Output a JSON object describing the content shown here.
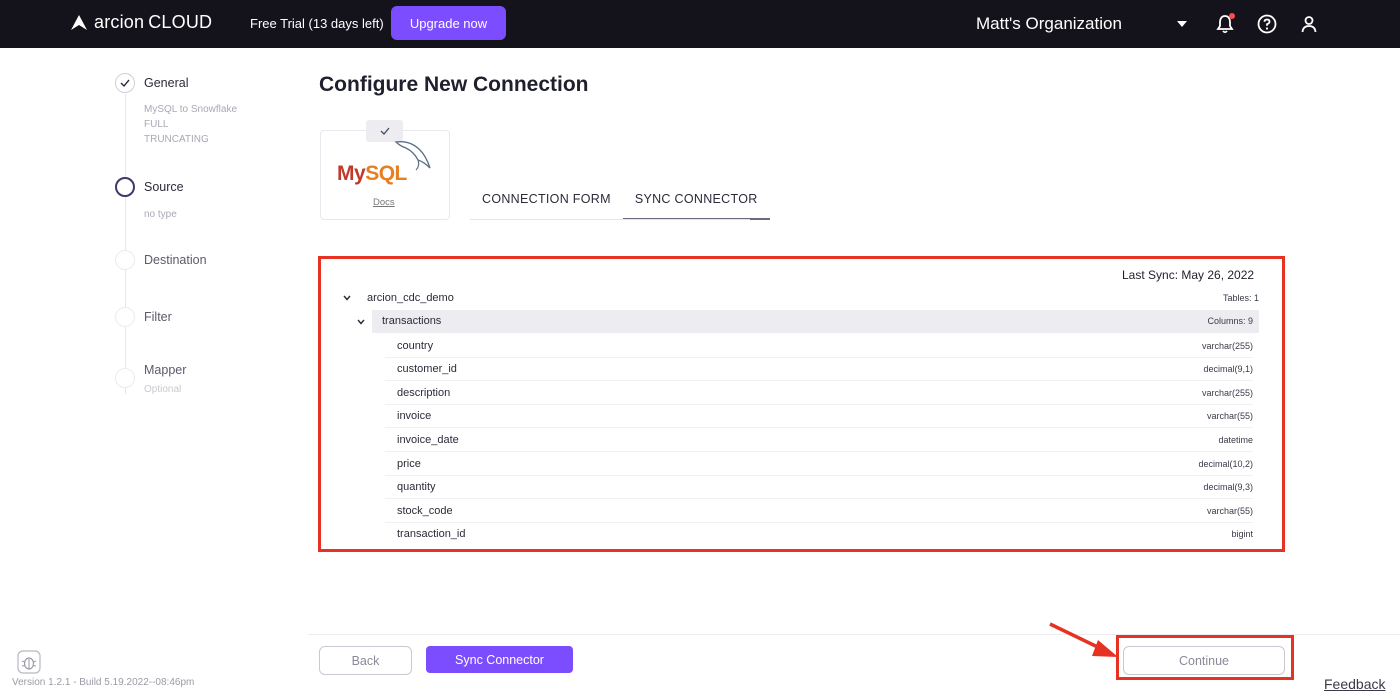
{
  "topbar": {
    "brand": "arcion",
    "brand_suffix": "CLOUD",
    "trial_text": "Free Trial (13 days left)",
    "upgrade_label": "Upgrade now",
    "organization": "Matt's Organization",
    "icons": [
      "bell-icon",
      "help-icon",
      "user-icon"
    ]
  },
  "steps": [
    {
      "label": "General",
      "state": "done",
      "details": [
        "MySQL to Snowflake",
        "FULL",
        "TRUNCATING"
      ]
    },
    {
      "label": "Source",
      "state": "active",
      "details": [
        "no type"
      ]
    },
    {
      "label": "Destination",
      "state": "pending",
      "details": []
    },
    {
      "label": "Filter",
      "state": "pending",
      "details": []
    },
    {
      "label": "Mapper",
      "state": "pending",
      "details": [
        "Optional"
      ]
    }
  ],
  "main": {
    "title": "Configure New Connection",
    "connector": {
      "logo_text_1": "My",
      "logo_text_2": "SQL",
      "docs_label": "Docs"
    },
    "tabs": [
      {
        "label": "CONNECTION FORM",
        "active": false
      },
      {
        "label": "SYNC CONNECTOR",
        "active": true
      }
    ],
    "last_sync": "Last Sync: May 26, 2022",
    "schema": {
      "name": "arcion_cdc_demo",
      "meta": "Tables: 1",
      "table": {
        "name": "transactions",
        "meta": "Columns: 9",
        "columns": [
          {
            "name": "country",
            "type": "varchar(255)"
          },
          {
            "name": "customer_id",
            "type": "decimal(9,1)"
          },
          {
            "name": "description",
            "type": "varchar(255)"
          },
          {
            "name": "invoice",
            "type": "varchar(55)"
          },
          {
            "name": "invoice_date",
            "type": "datetime"
          },
          {
            "name": "price",
            "type": "decimal(10,2)"
          },
          {
            "name": "quantity",
            "type": "decimal(9,3)"
          },
          {
            "name": "stock_code",
            "type": "varchar(55)"
          },
          {
            "name": "transaction_id",
            "type": "bigint"
          }
        ]
      }
    }
  },
  "footer": {
    "back_label": "Back",
    "sync_label": "Sync Connector",
    "continue_label": "Continue",
    "version": "Version 1.2.1 - Build 5.19.2022--08:46pm",
    "feedback": "Feedback"
  },
  "colors": {
    "accent": "#7b4dff",
    "topbar": "#14131c",
    "highlight": "#e63222"
  }
}
